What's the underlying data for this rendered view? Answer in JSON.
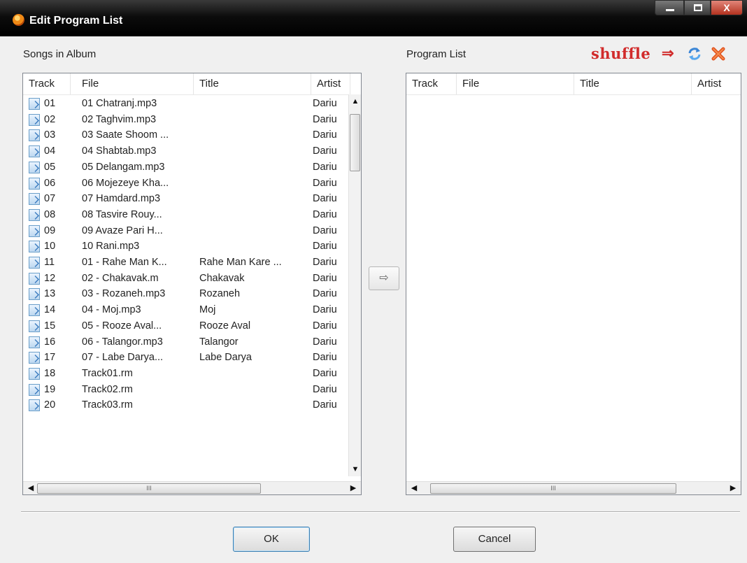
{
  "window": {
    "title": "Edit Program List",
    "controls": {
      "minimize": "",
      "maximize": "",
      "close": "X"
    }
  },
  "songs_panel": {
    "label": "Songs in Album",
    "columns": [
      "Track",
      "File",
      "Title",
      "Artist"
    ],
    "rows": [
      {
        "track": "01",
        "file": "01 Chatranj.mp3",
        "title": "",
        "artist": "Dariu"
      },
      {
        "track": "02",
        "file": "02 Taghvim.mp3",
        "title": "",
        "artist": "Dariu"
      },
      {
        "track": "03",
        "file": "03 Saate Shoom ...",
        "title": "",
        "artist": "Dariu"
      },
      {
        "track": "04",
        "file": "04 Shabtab.mp3",
        "title": "",
        "artist": "Dariu"
      },
      {
        "track": "05",
        "file": "05 Delangam.mp3",
        "title": "",
        "artist": "Dariu"
      },
      {
        "track": "06",
        "file": "06 Mojezeye Kha...",
        "title": "",
        "artist": "Dariu"
      },
      {
        "track": "07",
        "file": "07 Hamdard.mp3",
        "title": "",
        "artist": "Dariu"
      },
      {
        "track": "08",
        "file": "08 Tasvire Rouy...",
        "title": "",
        "artist": "Dariu"
      },
      {
        "track": "09",
        "file": "09 Avaze Pari H...",
        "title": "",
        "artist": "Dariu"
      },
      {
        "track": "10",
        "file": "10 Rani.mp3",
        "title": "",
        "artist": "Dariu"
      },
      {
        "track": "11",
        "file": "01 - Rahe Man K...",
        "title": "Rahe Man Kare ...",
        "artist": "Dariu"
      },
      {
        "track": "12",
        "file": "02 - Chakavak.m",
        "title": "Chakavak",
        "artist": "Dariu"
      },
      {
        "track": "13",
        "file": "03 - Rozaneh.mp3",
        "title": "Rozaneh",
        "artist": "Dariu"
      },
      {
        "track": "14",
        "file": "04 - Moj.mp3",
        "title": "Moj",
        "artist": "Dariu"
      },
      {
        "track": "15",
        "file": "05 - Rooze Aval...",
        "title": "Rooze Aval",
        "artist": "Dariu"
      },
      {
        "track": "16",
        "file": "06 - Talangor.mp3",
        "title": "Talangor",
        "artist": "Dariu"
      },
      {
        "track": "17",
        "file": "07 - Labe Darya...",
        "title": "Labe Darya",
        "artist": "Dariu"
      },
      {
        "track": "18",
        "file": "Track01.rm",
        "title": "",
        "artist": "Dariu"
      },
      {
        "track": "19",
        "file": "Track02.rm",
        "title": "",
        "artist": "Dariu"
      },
      {
        "track": "20",
        "file": "Track03.rm",
        "title": "",
        "artist": "Dariu"
      }
    ]
  },
  "program_panel": {
    "label": "Program List",
    "columns": [
      "Track",
      "File",
      "Title",
      "Artist"
    ],
    "shuffle_label": "shuffle",
    "shuffle_arrow": "⇒"
  },
  "scroll": {
    "up": "▲",
    "down": "▼",
    "left": "◀",
    "right": "▶",
    "grip": "III"
  },
  "add_button": "⇨",
  "buttons": {
    "ok": "OK",
    "cancel": "Cancel"
  },
  "colors": {
    "shuffle": "#d12b2b",
    "titlebar": "#000000",
    "accent": "#3c7fb1"
  }
}
